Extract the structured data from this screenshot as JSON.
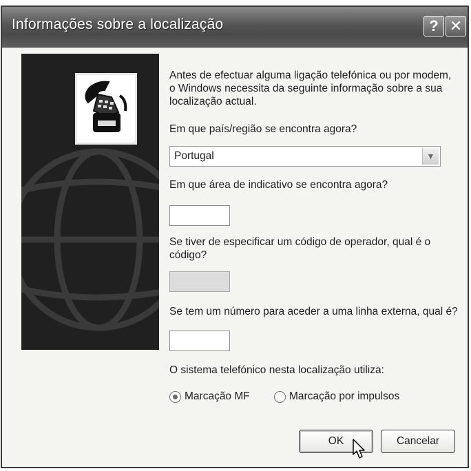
{
  "window": {
    "title": "Informações sobre a localização",
    "help_icon": "help-icon",
    "close_icon": "close-icon"
  },
  "intro_text": "Antes de efectuar alguma ligação telefónica ou por modem, o Windows necessita da seguinte informação sobre a sua localização actual.",
  "country": {
    "label": "Em que país/região se encontra agora?",
    "value": "Portugal"
  },
  "area_code": {
    "label": "Em que área de indicativo se encontra agora?",
    "value": ""
  },
  "carrier_code": {
    "label": "Se tiver de especificar um código de operador, qual é o código?",
    "value": ""
  },
  "outside_line": {
    "label": "Se tem um número para aceder a uma linha externa, qual é?",
    "value": ""
  },
  "dialing": {
    "label": "O sistema telefónico nesta localização utiliza:",
    "options": [
      {
        "label": "Marcação MF",
        "checked": true
      },
      {
        "label": "Marcação por impulsos",
        "checked": false
      }
    ]
  },
  "buttons": {
    "ok": "OK",
    "cancel": "Cancelar"
  },
  "icons": {
    "phone": "telephone-icon",
    "globe": "globe-icon",
    "cursor": "mouse-cursor-icon"
  }
}
